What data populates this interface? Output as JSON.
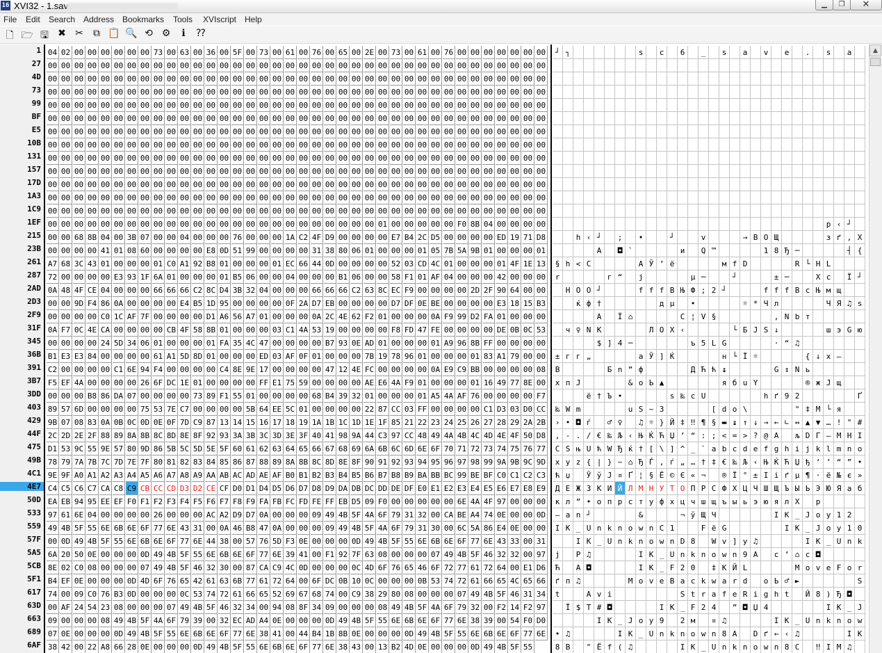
{
  "window": {
    "title": "XVI32 - 1.save",
    "icon_name": "xvi32-icon"
  },
  "menu": [
    "File",
    "Edit",
    "Search",
    "Address",
    "Bookmarks",
    "Tools",
    "XVIscript",
    "Help"
  ],
  "toolbar": [
    "new-file-icon",
    "open-folder-icon",
    "save-disk-icon",
    "close-x-icon",
    "cut-scissors-icon",
    "copy-icon",
    "paste-icon",
    "find-magnifier-icon",
    "replace-icon",
    "properties-icon",
    "info-icon",
    "help-pointer-icon"
  ],
  "colors": {
    "selection": "#3aa7e8",
    "modified_text": "#e02020",
    "address_bg": "#f0f0f0",
    "window_bg": "#f3f3f3"
  },
  "editor": {
    "selected_address": "4E7",
    "cursor_column": 6,
    "rows": [
      {
        "addr": "1",
        "hex": "04 02 00 00 00 00 00 00 73 00 63 00 36 00 5F 00 73 00 61 00 76 00 65 00 2E 00 73 00 61 00 76 00 00 00 00 00 00 00",
        "txt": "┘┐      s c 6 _ s a v e . s a v       "
      },
      {
        "addr": "27",
        "hex": "00 00 00 00 00 00 00 00 00 00 00 00 00 00 00 00 00 00 00 00 00 00 00 00 00 00 00 00 00 00 00 00 00 00 00 00 00 00",
        "txt": ""
      },
      {
        "addr": "4D",
        "hex": "00 00 00 00 00 00 00 00 00 00 00 00 00 00 00 00 00 00 00 00 00 00 00 00 00 00 00 00 00 00 00 00 00 00 00 00 00 00",
        "txt": ""
      },
      {
        "addr": "73",
        "hex": "00 00 00 00 00 00 00 00 00 00 00 00 00 00 00 00 00 00 00 00 00 00 00 00 00 00 00 00 00 00 00 00 00 00 00 00 00 00",
        "txt": ""
      },
      {
        "addr": "99",
        "hex": "00 00 00 00 00 00 00 00 00 00 00 00 00 00 00 00 00 00 00 00 00 00 00 00 00 00 00 00 00 00 00 00 00 00 00 00 00 00",
        "txt": ""
      },
      {
        "addr": "BF",
        "hex": "00 00 00 00 00 00 00 00 00 00 00 00 00 00 00 00 00 00 00 00 00 00 00 00 00 00 00 00 00 00 00 00 00 00 00 00 00 00",
        "txt": ""
      },
      {
        "addr": "E5",
        "hex": "00 00 00 00 00 00 00 00 00 00 00 00 00 00 00 00 00 00 00 00 00 00 00 00 00 00 00 00 00 00 00 00 00 00 00 00 00 00",
        "txt": ""
      },
      {
        "addr": "10B",
        "hex": "00 00 00 00 00 00 00 00 00 00 00 00 00 00 00 00 00 00 00 00 00 00 00 00 00 00 00 00 00 00 00 00 00 00 00 00 00 00",
        "txt": ""
      },
      {
        "addr": "131",
        "hex": "00 00 00 00 00 00 00 00 00 00 00 00 00 00 00 00 00 00 00 00 00 00 00 00 00 00 00 00 00 00 00 00 00 00 00 00 00 00",
        "txt": ""
      },
      {
        "addr": "157",
        "hex": "00 00 00 00 00 00 00 00 00 00 00 00 00 00 00 00 00 00 00 00 00 00 00 00 00 00 00 00 00 00 00 00 00 00 00 00 00 00",
        "txt": ""
      },
      {
        "addr": "17D",
        "hex": "00 00 00 00 00 00 00 00 00 00 00 00 00 00 00 00 00 00 00 00 00 00 00 00 00 00 00 00 00 00 00 00 00 00 00 00 00 00",
        "txt": ""
      },
      {
        "addr": "1A3",
        "hex": "00 00 00 00 00 00 00 00 00 00 00 00 00 00 00 00 00 00 00 00 00 00 00 00 00 00 00 00 00 00 00 00 00 00 00 00 00 00",
        "txt": ""
      },
      {
        "addr": "1C9",
        "hex": "00 00 00 00 00 00 00 00 00 00 00 00 00 00 00 00 00 00 00 00 00 00 00 00 00 00 00 00 00 00 00 00 00 00 00 00 00 00",
        "txt": ""
      },
      {
        "addr": "1EF",
        "hex": "00 00 00 00 00 00 00 00 00 00 00 00 00 00 00 00 00 00 00 00 00 00 00 00 00 01 00 00 00 00 00 F0 8B 04 00 00 00 00",
        "txt": "                          р‹┘    "
      },
      {
        "addr": "215",
        "hex": "00 00 68 8B 04 00 3B 07 00 00 04 00 00 00 76 00 00 00 1A C2 4F D9 00 00 00 00 E7 B4 2C D5 00 00 00 00 ED 19 71 D8",
        "txt": "  h‹┘ ; •  ┘  v   →ВОЩ    зґ,Х    н┼qШ"
      },
      {
        "addr": "23B",
        "hex": "00 00 00 00 41 01 08 60 00 00 00 00 E8 0D 51 99 00 00 00 00 31 38 80 06 01 00 00 00 01 05 7B 5A 9B 01 00 00 00 01",
        "txt": "    А ◘`    и Q™    18Ђ─    ┤{Z›    "
      },
      {
        "addr": "261",
        "hex": "A7 68 3C 43 01 00 00 00 01 C0 A1 92 B8 01 00 00 00 01 EC 66 44 0D 00 00 00 00 52 03 CD 4C 01 00 00 00 01 4F 1E 13",
        "txt": "§h<C    АЎ’ё    мfD    R└НL    О  ‼"
      },
      {
        "addr": "287",
        "hex": "72 00 00 00 00 E3 93 1F 6A 01 00 00 00 01 B5 06 00 00 04 00 00 00 B1 06 00 00 58 F1 01 AF 04 00 00 00 42 00 00 00",
        "txt": "r    г“ j    µ─  ┘   ±─  Xс Ї┘   B   "
      },
      {
        "addr": "2AD",
        "hex": "0A 48 4F CE 04 00 00 00 66 66 66 C2 8C D4 3B 32 04 00 00 00 66 66 66 C2 63 8C EC F9 00 00 00 00 2D 2F 90 64 00 00",
        "txt": " HOO┘   fffВЊФ;2┘   fffВcЊмщ    -/ђd  "
      },
      {
        "addr": "2D3",
        "hex": "00 00 9D F4 86 0A 00 00 00 00 E4 B5 1D 95 00 00 00 00 0F 2A D7 EB 00 00 00 00 D7 DF 0E BE 00 00 00 00 E3 18 15 B3",
        "txt": "  ќф†     дµ •    ☼*Чл    ЧЯ♫ѕ    г↑§і"
      },
      {
        "addr": "2F9",
        "hex": "00 00 00 00 C0 1C AF 7F 00 00 00 00 D1 A6 56 A7 01 00 00 00 0A 2C 4E 62 F2 01 00 00 00 0A F9 99 D2 FA 01 00 00 00",
        "txt": "    А Ї⌂    С¦V§     ,Nbт     щ™Тъ    "
      },
      {
        "addr": "31F",
        "hex": "0A F7 0C 4E CA 00 00 00 00 CB 4F 58 8B 01 00 00 00 03 C1 4A 53 19 00 00 00 00 F8 FD 47 FE 00 00 00 00 DE 0B 0C 53",
        "txt": " ч♀NK    ЛОХ‹    └БJS↓    шэGю    Ю♂♀S"
      },
      {
        "addr": "345",
        "hex": "00 00 00 00 24 5D 34 06 01 00 00 00 01 FA 35 4C 47 00 00 00 00 B7 93 0E AD 01 00 00 00 01 A9 96 8B FF 00 00 00 00",
        "txt": "    $]4─     ъ5LG    ·“♫­     ©–‹я    "
      },
      {
        "addr": "36B",
        "hex": "B1 E3 E3 84 00 00 00 00 61 A1 5D 8D 01 00 00 00 ED 03 AF 0F 01 00 00 00 7B 19 78 96 01 00 00 00 01 83 A1 79 00 00",
        "txt": "±гг„    аЎ]Ќ    н└Ї☼    {↓x–     ѓЎy  "
      },
      {
        "addr": "391",
        "hex": "C2 00 00 00 00 C1 6E 94 F4 00 00 00 00 C4 8E 9E 17 00 00 00 00 47 12 4E FC 00 00 00 00 0A E9 C9 BB 00 00 00 00 08",
        "txt": "В    Бn”ф    ДЋћ↨    G↕Nь     йЙ»    ◘"
      },
      {
        "addr": "3B7",
        "hex": "F5 EF 4A 00 00 00 00 26 6F DC 1E 01 00 00 00 00 FF E1 75 59 00 00 00 00 AE E6 4A F9 01 00 00 00 01 16 49 77 8E 00",
        "txt": "хпJ    &oЬ▲     ябuY    ®жJщ     ▬IwЋ "
      },
      {
        "addr": "3DD",
        "hex": "00 00 00 B8 86 DA 07 00 00 00 00 73 89 F1 55 01 00 00 00 00 68 B4 39 32 01 00 00 00 01 A5 4A AF 76 00 00 00 00 F7",
        "txt": "   ё†Ъ•    s‰сU     hґ92     ҐJЇv    ч"
      },
      {
        "addr": "403",
        "hex": "89 57 6D 00 00 00 00 75 53 7E C7 00 00 00 00 5B 64 EE 5C 01 00 00 00 00 22 87 CC 03 FF 00 00 00 00 C1 D3 03 D0 CC",
        "txt": "‰Wm    uS~З    [dо\\    \"‡М└я    БУ└РМ"
      },
      {
        "addr": "429",
        "hex": "9B 07 08 83 0A 0B 0C 0D 0E 0F 7D C9 87 13 14 15 16 17 18 19 1A 1B 1C 1D 1E 1F 85 21 22 23 24 25 26 27 28 29 2A 2B",
        "txt": "›•◘ѓ ♂♀ ♫☼}Й‡‼¶§▬↨↑↓→←∟↔▲▼…!\"#$%&'()*+"
      },
      {
        "addr": "44F",
        "hex": "2C 2D 2E 2F 88 89 8A 8B 8C 8D 8E 8F 92 93 3A 3B 3C 3D 3E 3F 40 41 98 9A 44 C3 97 CC 48 49 4A 4B 4C 4D 4E 4F 50 D8",
        "txt": ",-./€‰Љ‹ЊЌЋЏ’“:;<=>?@A љDГ—МHIJKLMNOPШ"
      },
      {
        "addr": "475",
        "hex": "D1 53 9C 55 9E 57 80 9D 86 5B 5C 5D 5E 5F 60 61 62 63 64 65 66 67 68 69 6A 6B 6C 6D 6E 6F 70 71 72 73 74 75 76 77",
        "txt": "СSњUћWЂќ†[\\]^_`abcdefghijklmnopqrstuvw"
      },
      {
        "addr": "49B",
        "hex": "78 79 7A 7B 7C 7D 7E 7F 80 81 82 83 84 85 86 87 88 89 8A 8B 8C 8D 8E 8F 90 91 92 93 94 95 96 97 98 99 9A 9B 9C 9D",
        "txt": "xyz{|}~⌂ЂЃ‚ѓ„…†‡€‰Љ‹ЊЌЋЏђ‘’“”•–— ™љ›њќ"
      },
      {
        "addr": "4C1",
        "hex": "9E 9F A0 A1 A2 A3 A4 A5 A6 A7 A8 A9 AA AB AC AD AE AF B0 B1 B2 B3 B4 B5 B6 B7 B8 B9 BA BB BC 99 BE BF C0 C1 C2 C3",
        "txt": "ћџ ЎўЈ¤Ґ¦§Ё©Є«¬­®Ї°±Ііґµ¶·ё№є»ј™ѕїАБВГ"
      },
      {
        "addr": "4E7",
        "hex": "C4 C5 C6 C7 CA C8 C9 CB CC CD D3 D2 CE CF D0 D1 D4 D5 D6 D7 D8 D9 DA DB DC DD DE DF E0 E1 E2 E3 E4 E5 E6 E7 E8 E9",
        "txt": "ДЕЖЗКИЙЛМНУТОПРСФХЦЧШЩЪЫЬЭЮЯабвгдежзий"
      },
      {
        "addr": "50D",
        "hex": "EA EB 94 95 EE EF F0 F1 F2 F3 F4 F5 F6 F7 F8 F9 FA FB FC FD FE FF EB D5 09 F0 00 00 00 00 00 6E 4A 4F 97 00 00 00",
        "txt": "кл”•опрстуфхцчшщъыьэюялХ р     nJO—   "
      },
      {
        "addr": "533",
        "hex": "97 61 6E 04 00 00 00 00 26 00 00 00 AC A2 D9 D7 0A 00 00 00 09 49 4B 5F 4A 6F 79 31 32 00 CA BE A4 74 0E 00 00 0D",
        "txt": "—an┘    &   ¬ўЩЧ     IK_Joy12 Кѕ¤t♫  "
      },
      {
        "addr": "559",
        "hex": "49 4B 5F 55 6E 6B 6E 6F 77 6E 43 31 00 0A 46 B8 47 0A 00 00 00 09 49 4B 5F 4A 6F 79 31 30 00 6C 5A 86 E4 0E 00 00",
        "txt": "IK_UnknownC1  FёG     IK_Joy10 lZ†д♫  "
      },
      {
        "addr": "57F",
        "hex": "00 0D 49 4B 5F 55 6E 6B 6E 6F 77 6E 44 38 00 57 76 5D F3 0E 00 00 00 0D 49 4B 5F 55 6E 6B 6E 6F 77 6E 43 33 00 31",
        "txt": "  IK_UnknownD8 Wv]у♫    IK_UnknownC3 1"
      },
      {
        "addr": "5A5",
        "hex": "6A 20 50 0E 00 00 00 0D 49 4B 5F 55 6E 6B 6E 6F 77 6E 39 41 00 F1 92 7F 63 08 00 00 00 07 49 4B 5F 46 32 32 00 97",
        "txt": "j P♫    IK_Unknown9A с’⌂c◘    IK_F22 —"
      },
      {
        "addr": "5CB",
        "hex": "8E 02 C0 08 00 00 00 07 49 4B 5F 46 32 30 00 87 CA C9 4C 0D 00 00 00 0C 4D 6F 76 65 46 6F 72 77 61 72 64 00 E1 D6",
        "txt": "Ћ А◘    IK_F20 ‡КЙL    MoveForward бЦ"
      },
      {
        "addr": "5F1",
        "hex": "B4 EF 0E 00 00 00 0D 4D 6F 76 65 42 61 63 6B 77 61 72 64 00 6F DC 0B 10 0C 00 00 00 0B 53 74 72 61 66 65 4C 65 66",
        "txt": "ґп♫    MoveBackward oЬ♂►     StrafeLef"
      },
      {
        "addr": "617",
        "hex": "74 00 09 C0 76 B3 0D 00 00 00 0C 53 74 72 61 66 65 52 69 67 68 74 00 C9 38 29 80 08 00 00 00 07 49 4B 5F 46 31 34",
        "txt": "t  Avi      StrafeRight Й8)Ђ◘    IK_F14"
      },
      {
        "addr": "63D",
        "hex": "00 AF 24 54 23 08 00 00 00 07 49 4B 5F 46 32 34 00 94 08 8F 34 09 00 00 00 08 49 4B 5F 4A 6F 79 32 00 F2 14 F2 97",
        "txt": " Ї$T#◘    IK_F24 ”◘Џ4     IK_Joy2 т¶т—"
      },
      {
        "addr": "663",
        "hex": "09 00 00 00 08 49 4B 5F 4A 6F 79 39 00 32 EC AD A4 0E 00 00 00 0D 49 4B 5F 55 6E 6B 6E 6F 77 6E 38 39 00 54 F0 D0",
        "txt": "    IK_Joy9 2м­¤♫    IK_Unknown89 TрР"
      },
      {
        "addr": "689",
        "hex": "07 0E 00 00 00 0D 49 4B 5F 55 6E 6B 6E 6F 77 6E 38 41 00 44 B4 1B 8B 0E 00 00 00 0D 49 4B 5F 55 6E 6B 6E 6F 77 6E",
        "txt": "•♫    IK_Unknown8A Dґ←‹♫    IK_Unknown"
      },
      {
        "addr": "6AF",
        "hex": "38 42 00 22 A8 66 28 0E 00 00 00 0D 49 4B 5F 55 6E 6B 6E 6F 77 6E 38 43 00 13 B2 4D 0E 00 00 00 0D 49 4B 5F 55",
        "txt": "8B \"Ёf(♫    IK_Unknown8C ‼ІМ♫    IK_U"
      }
    ]
  }
}
